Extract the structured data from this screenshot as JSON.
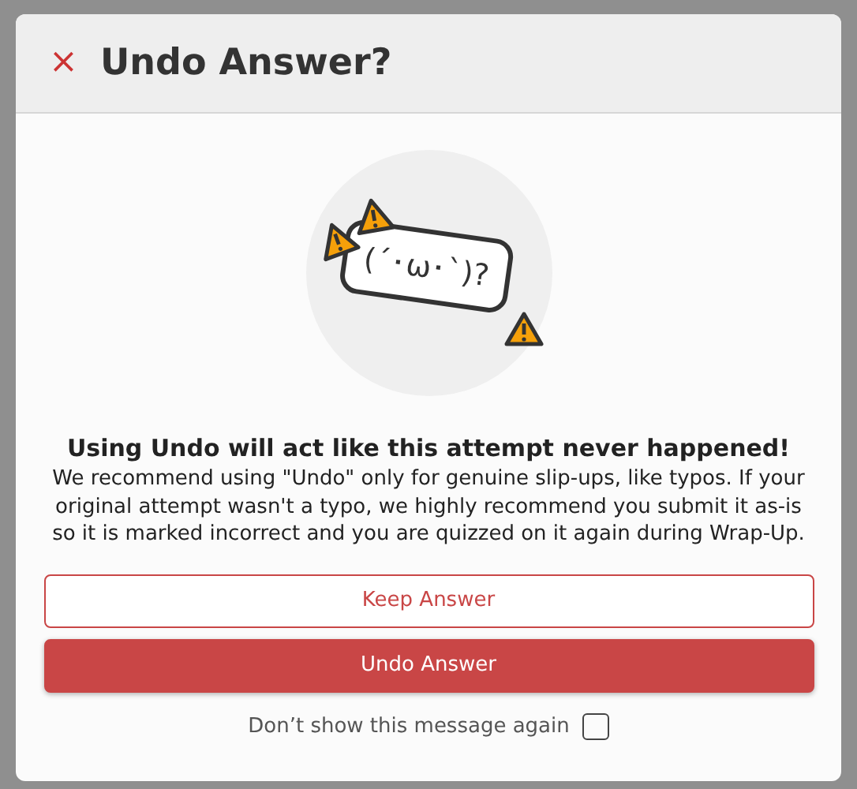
{
  "dialog": {
    "title": "Undo Answer?",
    "close_icon": "×",
    "illustration": {
      "kaomoji": "(´･ω･`)?"
    },
    "heading": "Using Undo will act like this attempt never happened!",
    "message": "We recommend using \"Undo\" only for genuine slip-ups, like typos. If your original attempt wasn't a typo, we highly recommend you submit it as-is so it is marked incorrect and you are quizzed on it again during Wrap-Up.",
    "buttons": [
      {
        "label": "Keep Answer",
        "kind": "outline"
      },
      {
        "label": "Undo Answer",
        "kind": "filled"
      }
    ],
    "dont_show": {
      "label": "Don’t show this message again",
      "checked": false
    }
  }
}
